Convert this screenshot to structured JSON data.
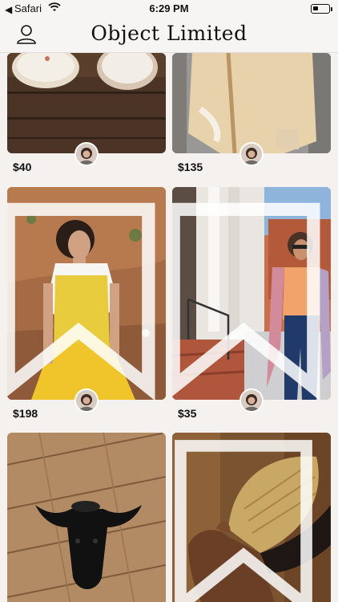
{
  "status_bar": {
    "back_app": "Safari",
    "time": "6:29 PM",
    "battery_level": 0.35
  },
  "header": {
    "title": "Object Limited",
    "user_icon": "user-icon"
  },
  "products": [
    {
      "price": "$40",
      "image": "cream-ceramic-bowls-on-wood"
    },
    {
      "price": "$135",
      "image": "cream-embroidered-coat"
    },
    {
      "price": "$198",
      "image": "yellow-sequin-top-and-skirt"
    },
    {
      "price": "$35",
      "image": "woman-in-orange-top-by-columns"
    },
    {
      "price": "",
      "image": "black-bull-skull-on-floor"
    },
    {
      "price": "",
      "image": "hand-holding-bristle-brush"
    }
  ],
  "colors": {
    "background": "#f4f1ef",
    "text": "#111111",
    "avatar_border": "#ffffff"
  }
}
